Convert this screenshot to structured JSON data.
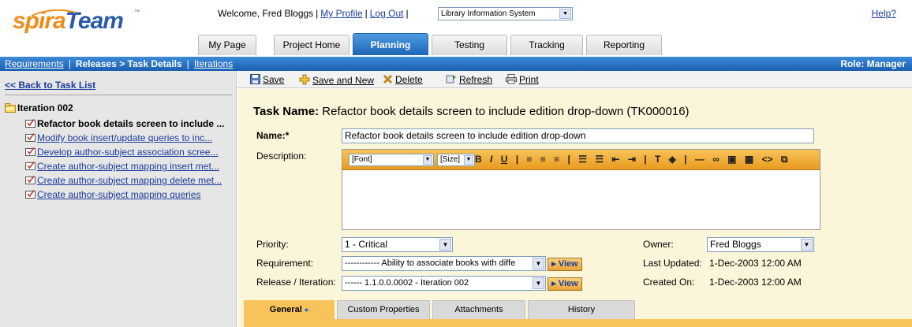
{
  "header": {
    "logo_spira": "spira",
    "logo_team": "Team",
    "logo_tm": "™",
    "welcome_text": "Welcome, Fred Bloggs",
    "my_profile": "My Profile",
    "log_out": "Log Out",
    "project": "Library Information System",
    "help": "Help?",
    "tabs": [
      {
        "label": "My Page"
      },
      {
        "label": "Project Home"
      },
      {
        "label": "Planning"
      },
      {
        "label": "Testing"
      },
      {
        "label": "Tracking"
      },
      {
        "label": "Reporting"
      }
    ]
  },
  "navbar": {
    "requirements": "Requirements",
    "current": "Releases > Task Details",
    "iterations": "Iterations",
    "role": "Role: Manager"
  },
  "sidebar": {
    "back_link": "<< Back to Task List",
    "root": "Iteration 002",
    "items": [
      {
        "label": "Refactor book details screen to include ..."
      },
      {
        "label": "Modify book insert/update queries to inc..."
      },
      {
        "label": "Develop author-subject association scree..."
      },
      {
        "label": "Create author-subject mapping insert met..."
      },
      {
        "label": "Create author-subject mapping delete met..."
      },
      {
        "label": "Create author-subject mapping queries"
      }
    ]
  },
  "toolbar": {
    "save": "Save",
    "save_and_new": "Save and New",
    "delete": "Delete",
    "refresh": "Refresh",
    "print": "Print"
  },
  "form": {
    "task_name_label": "Task Name:",
    "task_name_value": "Refactor book details screen to include edition drop-down (TK000016)",
    "name_label": "Name:*",
    "name_value": "Refactor book details screen to include edition drop-down",
    "description_label": "Description:",
    "editor_font": "[Font]",
    "editor_size": "[Size]",
    "priority_label": "Priority:",
    "priority_value": "1 - Critical",
    "requirement_label": "Requirement:",
    "requirement_value": "------------ Ability to associate books with diffe",
    "release_label": "Release / Iteration:",
    "release_value": "------ 1.1.0.0.0002 - Iteration 002",
    "view_button": "▸ View",
    "owner_label": "Owner:",
    "owner_value": "Fred Bloggs",
    "last_updated_label": "Last Updated:",
    "last_updated_value": "1-Dec-2003 12:00 AM",
    "created_on_label": "Created On:",
    "created_on_value": "1-Dec-2003 12:00 AM"
  },
  "bottom_tabs": [
    {
      "label": "General"
    },
    {
      "label": "Custom Properties"
    },
    {
      "label": "Attachments"
    },
    {
      "label": "History"
    }
  ],
  "colors": {
    "brand_orange": "#f08c1a",
    "brand_blue": "#2a5aa8",
    "nav_blue": "#1b5fb0",
    "form_bg": "#fbf5da",
    "accent_gold": "#f8c35a"
  }
}
